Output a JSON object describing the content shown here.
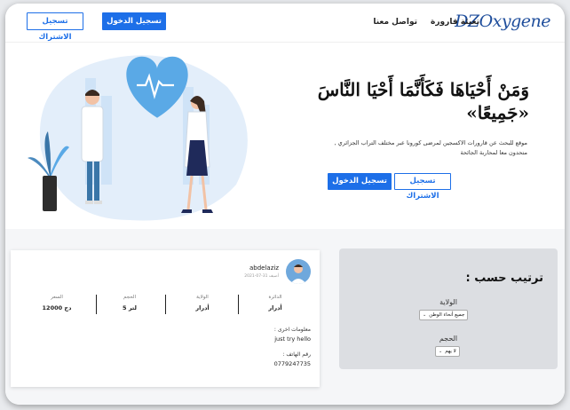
{
  "header": {
    "logo": "DZOxygene",
    "nav": [
      "تعبئة قارورة",
      "تواصل معنا"
    ],
    "login_label": "تسجيل الدخول",
    "signup_label": "تسجيل الاشتراك"
  },
  "hero": {
    "title": "وَمَنْ أَحْيَاهَا فَكَأَنَّمَا أَحْيَا النَّاسَ «جَمِيعًا»",
    "description": "موقع للبحث عن قارورات الاكسجين لمرضى كورونا عبر مختلف التراب الجزائري , متحدون معا لمحاربة الجائحة",
    "login_label": "تسجيل الدخول",
    "signup_label": "تسجيل الاشتراك"
  },
  "post": {
    "username": "abdelaziz",
    "date": "أضيف 31-07-2021",
    "columns": [
      {
        "label": "الدائرة",
        "value": "أدرار"
      },
      {
        "label": "الولاية",
        "value": "أدرار"
      },
      {
        "label": "الحجم",
        "value": "لتر 5"
      },
      {
        "label": "السعر",
        "value": "دج 12000"
      }
    ],
    "other_info_label": "معلومات اخرى :",
    "other_info_value": "just try hello",
    "phone_label": "رقم الهاتف :",
    "phone_value": "0779247735"
  },
  "sort": {
    "title": "ترتيب حسب :",
    "wilaya_label": "الولاية",
    "wilaya_value": "جميع أنحاء الوطن",
    "size_label": "الحجم",
    "size_value": "لا يهم"
  },
  "colors": {
    "primary": "#1d6fe8",
    "logo": "#1f4e9c",
    "illustration_light": "#cfe3f7",
    "heart": "#5aa9e6"
  }
}
